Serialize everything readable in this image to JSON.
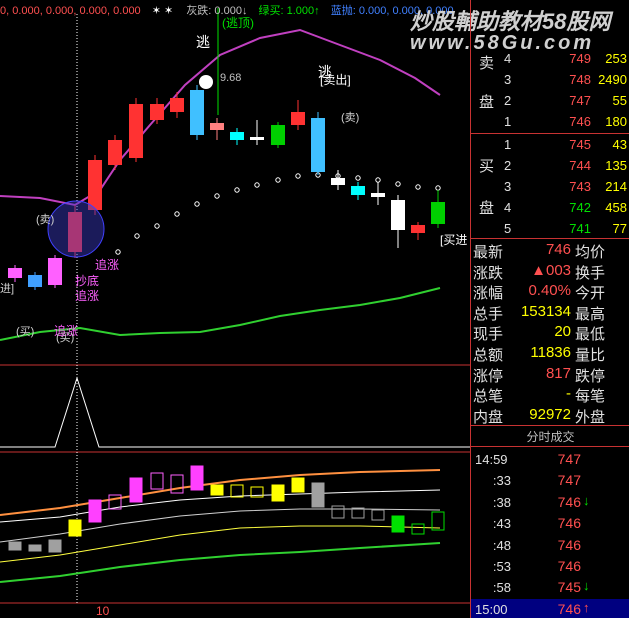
{
  "indicator_line": {
    "v1": "0, 0.000, 0.000, 0.000, 0.000",
    "star": "✶  ✶",
    "name": "灰跌: 0.000",
    "arrow_down": "↓",
    "green_label": "绿买: 1.000",
    "arrow_up": "↑",
    "blue_label": "蓝抛: 0.000, 0.000, 0.000"
  },
  "watermark": {
    "title": "炒股輔助教材58股网",
    "url": "www.58Gu.com"
  },
  "chart_annotations": {
    "escape_top_label": "(逃顶)",
    "escape_1": "逃",
    "escape_2": "逃",
    "sell_out": "[卖出]",
    "high_price": "9.68",
    "sell_1": "(卖)",
    "sell_2": "(卖)",
    "buy_1": "(买)",
    "buy_2": "(买)",
    "buy_in": "[买进",
    "bottom_1": "抄底",
    "bottom_2": "追涨",
    "chase_1": "追涨",
    "chase_2": "追涨",
    "left_bracket": "进]",
    "x_tick": "10"
  },
  "colors": {
    "up": "#ff3232",
    "down": "#00e000",
    "grid": "#c83232",
    "magenta": "#c040c0",
    "yellow": "#ffff00",
    "cyan": "#00ffff"
  },
  "order_book": {
    "sell_label": [
      "卖",
      "盘"
    ],
    "buy_label": [
      "买",
      "盘"
    ],
    "sell": [
      {
        "level": "4",
        "price": "749",
        "volume": "253"
      },
      {
        "level": "3",
        "price": "748",
        "volume": "2490"
      },
      {
        "level": "2",
        "price": "747",
        "volume": "55"
      },
      {
        "level": "1",
        "price": "746",
        "volume": "180"
      }
    ],
    "buy": [
      {
        "level": "1",
        "price": "745",
        "volume": "43"
      },
      {
        "level": "2",
        "price": "744",
        "volume": "135"
      },
      {
        "level": "3",
        "price": "743",
        "volume": "214"
      },
      {
        "level": "4",
        "price": "742",
        "volume": "458"
      },
      {
        "level": "5",
        "price": "741",
        "volume": "77"
      }
    ]
  },
  "quote": [
    {
      "k": "最新",
      "v": "746",
      "k2": "均价",
      "color": "#ff5050"
    },
    {
      "k": "涨跌",
      "v": "▲003",
      "k2": "换手",
      "color": "#ff5050"
    },
    {
      "k": "涨幅",
      "v": "0.40%",
      "k2": "今开",
      "color": "#ff5050"
    },
    {
      "k": "总手",
      "v": "153134",
      "k2": "最高",
      "color": "#ffff00"
    },
    {
      "k": "现手",
      "v": "20",
      "k2": "最低",
      "color": "#ffff00"
    },
    {
      "k": "总额",
      "v": "11836",
      "k2": "量比",
      "color": "#ffff00"
    },
    {
      "k": "涨停",
      "v": "817",
      "k2": "跌停",
      "color": "#ff5050"
    },
    {
      "k": "总笔",
      "v": "-",
      "k2": "每笔",
      "color": "#ffff00"
    },
    {
      "k": "内盘",
      "v": "92972",
      "k2": "外盘",
      "color": "#ffff00"
    }
  ],
  "ticks": {
    "title": "分时成交",
    "rows": [
      {
        "t": "14:59",
        "p": "747",
        "ar": ""
      },
      {
        "t": ":33",
        "p": "747",
        "ar": ""
      },
      {
        "t": ":38",
        "p": "746",
        "ar": "↓"
      },
      {
        "t": ":43",
        "p": "746",
        "ar": ""
      },
      {
        "t": ":48",
        "p": "746",
        "ar": ""
      },
      {
        "t": ":53",
        "p": "746",
        "ar": ""
      },
      {
        "t": ":58",
        "p": "745",
        "ar": "↓"
      },
      {
        "t": "15:00",
        "p": "746",
        "ar": "↑"
      }
    ]
  }
}
